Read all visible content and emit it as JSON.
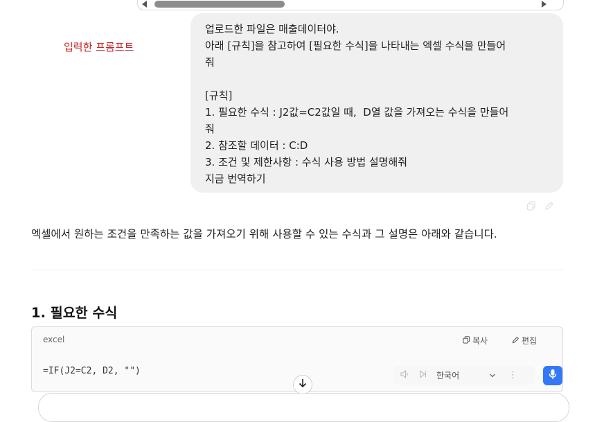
{
  "prompt_label": "입력한 프롬프트",
  "user_message": {
    "lines": [
      "업로드한 파일은 매출데이터야.",
      "아래 [규칙]을 참고하여 [필요한 수식]을 나타내는 엑셀 수식을 만들어",
      "줘",
      "",
      "[규칙]",
      "1. 필요한 수식 : J2값=C2값일 때,  D열 값을 가져오는 수식을 만들어",
      "줘",
      "2. 참조할 데이터 : C:D",
      "3. 조건 및 제한사항 : 수식 사용 방법 설명해줘",
      "지금 번역하기"
    ]
  },
  "answer": {
    "intro": "엑셀에서 원하는 조건을 만족하는 값을 가져오기 위해 사용할 수 있는 수식과 그 설명은 아래와 같습니다.",
    "section_heading": "1. 필요한 수식",
    "code_block": {
      "language": "excel",
      "copy_label": "복사",
      "edit_label": "편집",
      "code": "=IF(J2=C2, D2, \"\")"
    }
  },
  "tts": {
    "language": "한국어",
    "accent_color": "#3478f6"
  },
  "icons": {
    "copy": "copy-icon",
    "edit": "pencil-icon",
    "speaker": "speaker-icon",
    "skip": "skip-icon",
    "chevron": "chevron-down-icon",
    "more": "more-vertical-icon",
    "mic": "microphone-icon",
    "scroll_down": "arrow-down-icon"
  },
  "colors": {
    "prompt_label": "#c62828",
    "bubble_bg": "#f0f0f0"
  }
}
